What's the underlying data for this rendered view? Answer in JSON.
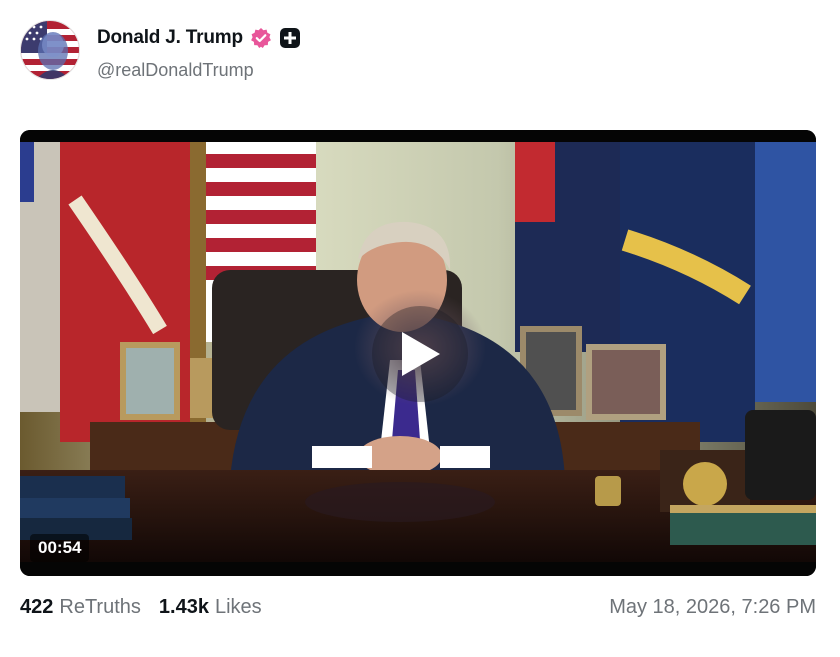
{
  "author": {
    "display_name": "Donald J. Trump",
    "handle": "@realDonaldTrump",
    "avatar_icon": "flag-portrait-avatar",
    "verified_icon": "verified-badge-icon",
    "verified_color": "#e8569a",
    "plus_icon": "plus-badge-icon"
  },
  "media": {
    "type": "video",
    "duration": "00:54",
    "play_icon": "play-icon"
  },
  "stats": {
    "retruths_count": "422",
    "retruths_label": "ReTruths",
    "likes_count": "1.43k",
    "likes_label": "Likes"
  },
  "timestamp": "May 18, 2026, 7:26 PM",
  "colors": {
    "text_primary": "#0f1419",
    "text_secondary": "#6e7378",
    "background": "#ffffff"
  }
}
